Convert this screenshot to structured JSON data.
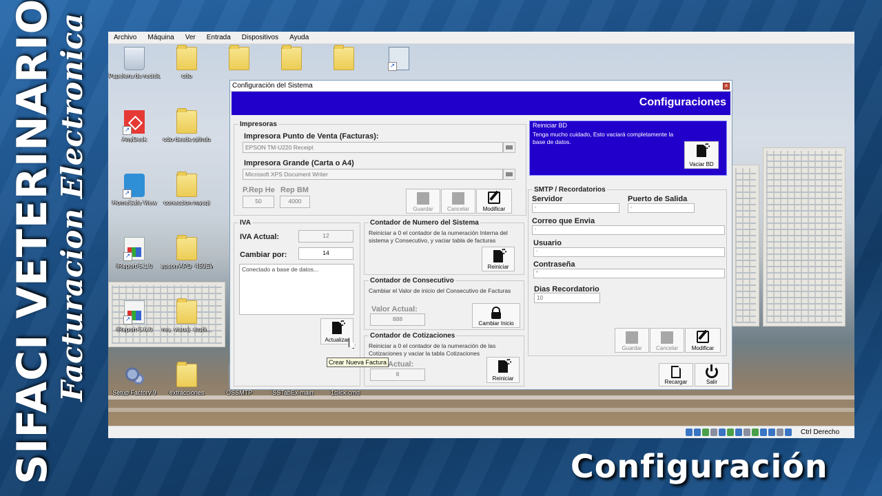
{
  "overlay": {
    "brand_vertical": "SIFACI VETERINARIO",
    "brand_script": "Facturacion Electronica",
    "caption": "Configuración"
  },
  "vm": {
    "menu": [
      "Archivo",
      "Máquina",
      "Ver",
      "Entrada",
      "Dispositivos",
      "Ayuda"
    ],
    "host_key": "Ctrl Derecho"
  },
  "desktop": {
    "icons": [
      {
        "label": "Papelera de reciclaje",
        "icon": "recycle-bin-icon"
      },
      {
        "label": "cdo",
        "icon": "folder-icon"
      },
      {
        "label": "AnyDesk",
        "icon": "anydesk-icon"
      },
      {
        "label": "cdo desde github",
        "icon": "folder-icon"
      },
      {
        "label": "HomeSafe View",
        "icon": "homesafe-icon"
      },
      {
        "label": "coneccion mysql",
        "icon": "folder-icon"
      },
      {
        "label": "iReport-5.1.0",
        "icon": "ireport-icon"
      },
      {
        "label": "epson APD_459EWM",
        "icon": "folder-icon"
      },
      {
        "label": "iReport-5.6.0",
        "icon": "ireport-icon"
      },
      {
        "label": "res_visual_studi...",
        "icon": "folder-icon"
      },
      {
        "label": "Setup Factory 9",
        "icon": "setup-factory-icon"
      },
      {
        "label": "extracciones",
        "icon": "folder-icon"
      },
      {
        "label": "OSSMTP",
        "icon": "file-icon"
      },
      {
        "label": "SSTabEx-main",
        "icon": "file-icon"
      },
      {
        "label": "1click.cmd",
        "icon": "cmd-icon"
      }
    ]
  },
  "config": {
    "window_title": "Configuración del Sistema",
    "header": "Configuraciones",
    "printers": {
      "title": "Impresoras",
      "pos_label": "Impresora Punto de Venta (Facturas):",
      "pos_value": "EPSON TM-U220 Receipt",
      "large_label": "Impresora Grande (Carta o A4)",
      "large_value": "Microsoft XPS Document Writer",
      "prep_he_label": "P.Rep He",
      "prep_he_value": "50",
      "rep_bm_label": "Rep BM",
      "rep_bm_value": "4000",
      "save": "Guardar",
      "cancel": "Cancelar",
      "modify": "Modificar"
    },
    "iva": {
      "title": "IVA",
      "current_label": "IVA Actual:",
      "current_value": "12",
      "change_label": "Cambiar por:",
      "change_value": "14",
      "log": "Conectado a base de datos...",
      "update": "Actualizar"
    },
    "system_counter": {
      "title": "Contador de Numero del Sistema",
      "note": "Reiniciar a 0 el contador de la numeración Interna del sistema y Consecutivo, y vaciar tabla de facturas",
      "restart": "Reiniciar"
    },
    "consecutive": {
      "title": "Contador de Consecutivo",
      "note": "Cambiar el Valor de inicio del Consecutivo de Facturas",
      "value_label": "Valor Actual:",
      "value": "888",
      "change_start": "Cambiar Inicio"
    },
    "quotes_counter": {
      "title": "Contador de Cotizaciones",
      "note": "Reiniciar a 0 el contador de la numeración de las Cotizaciones y vaciar la tabla Cotizaciones",
      "value_label": "Actual:",
      "value": "8",
      "restart": "Reiniciar"
    },
    "reset_db": {
      "title": "Reiniciar BD",
      "note": "Tenga mucho cuidado, Esto vaciará completamente la base de datos.",
      "button": "Vaciar BD"
    },
    "smtp": {
      "title": "SMTP / Recordatorios",
      "server_label": "Servidor",
      "server_value": "-",
      "port_label": "Puerto de Salida",
      "port_value": "-",
      "email_label": "Correo que Envia",
      "email_value": "-",
      "user_label": "Usuario",
      "user_value": "-",
      "password_label": "Contraseña",
      "password_value": "*",
      "days_label": "Dias Recordatorio",
      "days_value": "10",
      "save": "Guardar",
      "cancel": "Cancelar",
      "modify": "Modificar"
    },
    "reload": "Recargar",
    "exit": "Salir",
    "tooltip": "Crear Nueva Factura"
  }
}
